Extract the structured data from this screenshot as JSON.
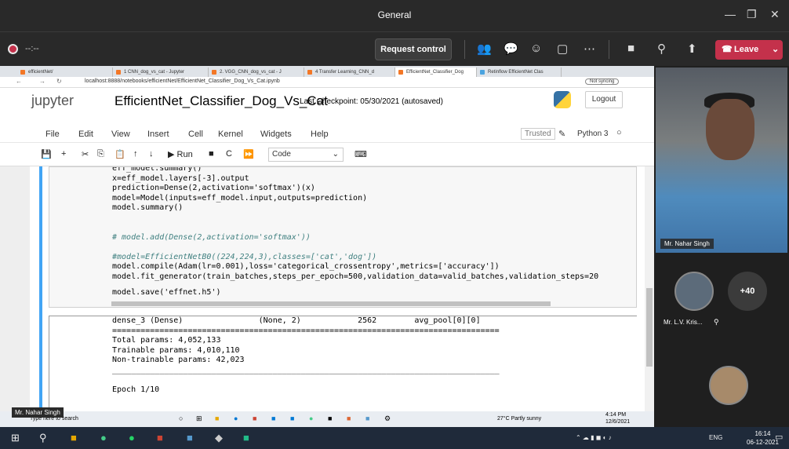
{
  "window": {
    "title": "General"
  },
  "meeting": {
    "timer": "--:--",
    "request_control": "Request control",
    "leave": "Leave"
  },
  "browser": {
    "tabs": [
      "efficientNet/",
      "1 CNN_dog_vs_cat - Jupyter",
      "2. VGG_CNN_dog_vs_cat - J",
      "4 Transfer Learning_CNN_d",
      "EfficientNet_Classifier_Dog",
      "Retinflow EfficientNet Clas"
    ],
    "url": "localhost:8888/notebooks/efficientNet/EfficientNet_Classifier_Dog_Vs_Cat.ipynb",
    "sync": "Not syncing"
  },
  "jupyter": {
    "logo": "jupyter",
    "notebook_title": "EfficientNet_Classifier_Dog_Vs_Cat",
    "checkpoint": "Last Checkpoint: 05/30/2021  (autosaved)",
    "logout": "Logout",
    "menu": [
      "File",
      "Edit",
      "View",
      "Insert",
      "Cell",
      "Kernel",
      "Widgets",
      "Help"
    ],
    "trusted": "Trusted",
    "kernel": "Python 3",
    "run_label": "Run",
    "cell_type": "Code"
  },
  "code_cell": {
    "lines": [
      "eff_model.summary()",
      "x=eff_model.layers[-3].output",
      "prediction=Dense(2,activation='softmax')(x)",
      "model=Model(inputs=eff_model.input,outputs=prediction)",
      "model.summary()",
      "# model.add(Dense(2,activation='softmax'))",
      "#model=EfficientNetB0((224,224,3),classes=['cat','dog'])",
      "model.compile(Adam(lr=0.001),loss='categorical_crossentropy',metrics=['accuracy'])",
      "model.fit_generator(train_batches,steps_per_epoch=500,validation_data=valid_batches,validation_steps=20",
      "model.save('effnet.h5')"
    ]
  },
  "output_cell": {
    "lines": [
      "dense_3 (Dense)                (None, 2)            2562        avg_pool[0][0]",
      "==================================================================================",
      "Total params: 4,052,133",
      "Trainable params: 4,010,110",
      "Non-trainable params: 42,023",
      "__________________________________________________________________________________",
      "",
      "Epoch 1/10"
    ]
  },
  "inner_taskbar": {
    "search": "Type here to search",
    "weather": "27°C  Partly sunny",
    "time": "4:14 PM",
    "date": "12/6/2021"
  },
  "presenter_tag": "Mr. Nahar Singh",
  "participants": {
    "main_video_name": "Mr. Nahar Singh",
    "second_name": "Mr. L.V. Kris...",
    "more_count": "+40"
  },
  "taskbar": {
    "lang": "ENG",
    "time": "16:14",
    "date": "06-12-2021"
  }
}
